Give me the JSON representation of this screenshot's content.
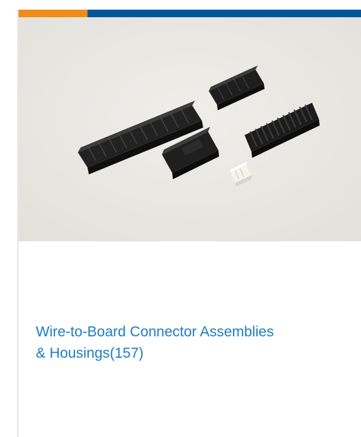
{
  "colors": {
    "accent_orange": "#f08c1a",
    "accent_blue": "#00569c",
    "link_blue": "#1c7cc4",
    "image_bg": "#e9e8e4",
    "connector_black": "#1a1a1a"
  },
  "card": {
    "image": {
      "icon": "connector-product-photo",
      "alt": "Wire-to-Board Connector Assemblies & Housings"
    },
    "title": {
      "line1": "Wire-to-Board Connector Assemblies",
      "line2": "& Housings(157)"
    }
  }
}
